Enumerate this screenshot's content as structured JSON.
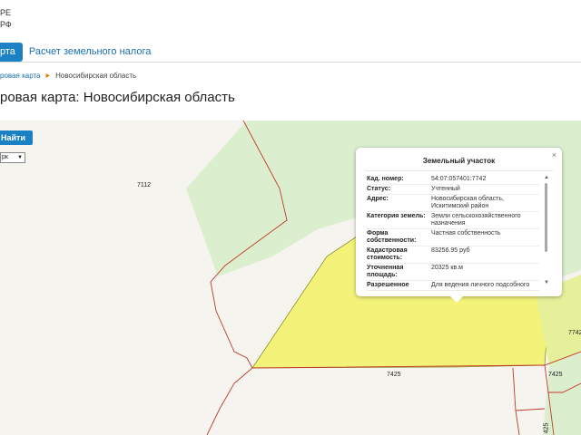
{
  "header": {
    "logo_line1": "РЕ",
    "logo_line2": "РФ"
  },
  "tabs": [
    {
      "label": "рта",
      "active": true
    },
    {
      "label": "Расчет земельного налога",
      "active": false
    }
  ],
  "breadcrumb": {
    "link": "ровая карта",
    "separator": "▶",
    "current": "Новосибирская область"
  },
  "page_title": "ровая карта: Новосибирская область",
  "map": {
    "find_button": "Найти",
    "layer_select": "рк",
    "parcel_labels": [
      "7112",
      "7425",
      "7425",
      "7742",
      "425"
    ]
  },
  "popup": {
    "title": "Земельный участок",
    "close": "×",
    "rows": [
      {
        "key": "Кад. номер:",
        "value": "54:07:057401:7742"
      },
      {
        "key": "Статус:",
        "value": "Учтенный"
      },
      {
        "key": "Адрес:",
        "value": "Новосибирская область, Искитимский район"
      },
      {
        "key": "Категория земель:",
        "value": "Земли сельскохозяйственного назначения"
      },
      {
        "key": "Форма собственности:",
        "value": "Частная собственность"
      },
      {
        "key": "Кадастровая стоимость:",
        "value": "83256.95 руб"
      },
      {
        "key": "Уточненная площадь:",
        "value": "20325 кв.м"
      },
      {
        "key": "Разрешенное",
        "value": "Для ведения личного подсобного"
      }
    ]
  },
  "colors": {
    "accent": "#1a82c4",
    "parcel_fill": "#f3f37a",
    "forest_fill": "#dbefcf",
    "boundary": "#c0392b"
  }
}
